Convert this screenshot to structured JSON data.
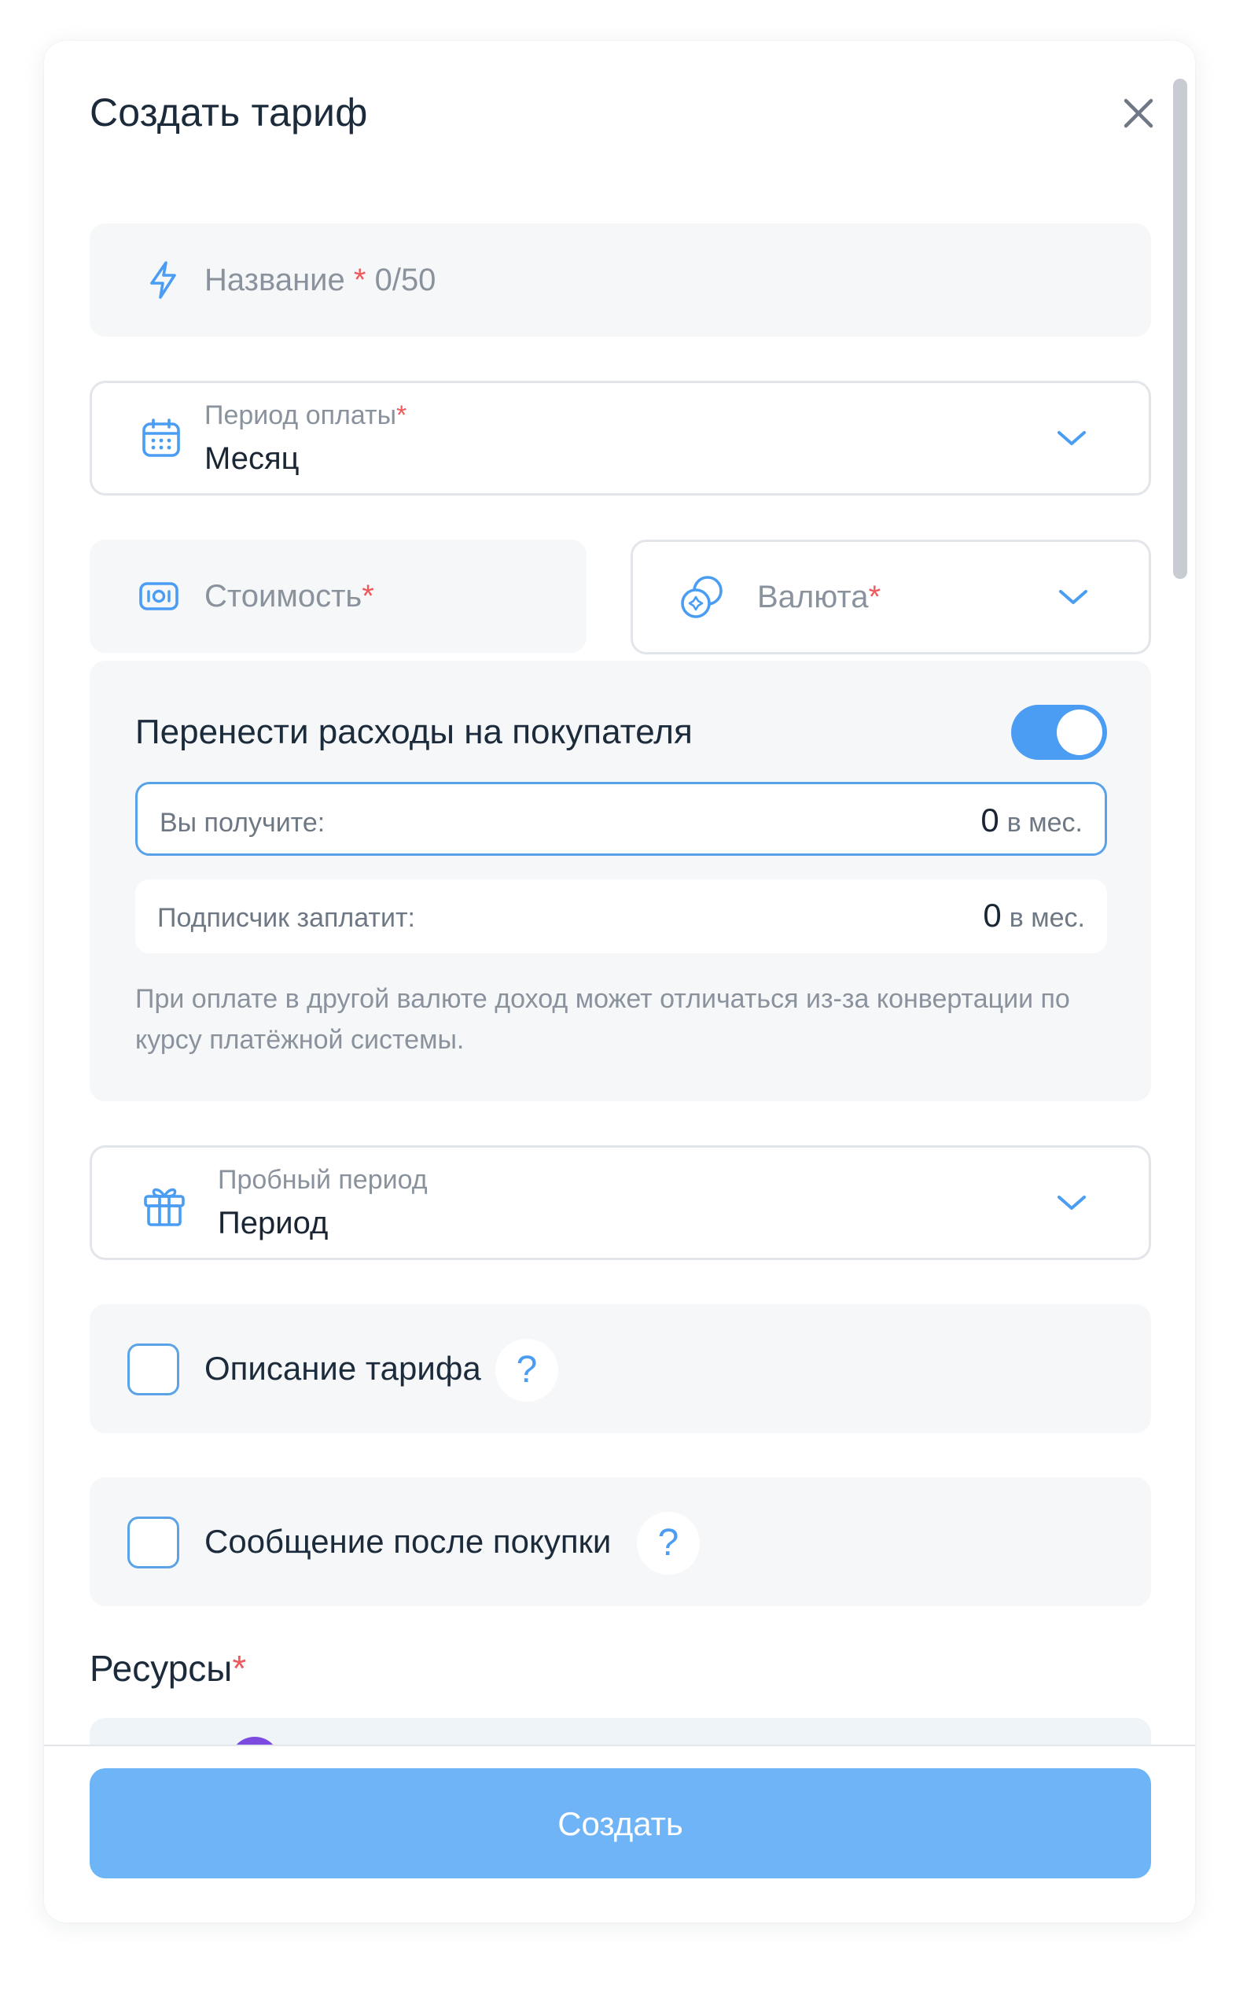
{
  "modal": {
    "title": "Создать тариф",
    "close_icon": "close-icon"
  },
  "name_field": {
    "placeholder": "Название",
    "required_mark": "*",
    "counter": "0/50",
    "icon": "lightning-icon"
  },
  "payment_period": {
    "label": "Период оплаты",
    "required_mark": "*",
    "value": "Месяц",
    "icon": "calendar-icon"
  },
  "price_field": {
    "placeholder": "Стоимость",
    "required_mark": "*",
    "icon": "money-icon"
  },
  "currency_field": {
    "placeholder": "Валюта",
    "required_mark": "*",
    "icon": "currency-icon"
  },
  "fees_panel": {
    "title": "Перенести расходы на покупателя",
    "toggle_on": true,
    "you_receive_label": "Вы получите:",
    "you_receive_value": "0",
    "subscriber_pays_label": "Подписчик заплатит:",
    "subscriber_pays_value": "0",
    "unit": "в мес.",
    "note": "При оплате в другой валюте доход может отличаться из-за конвертации по курсу платёжной системы."
  },
  "trial_period": {
    "label": "Пробный период",
    "value": "Период",
    "icon": "gift-icon"
  },
  "description_option": {
    "label": "Описание тарифа",
    "help": "?"
  },
  "after_purchase_option": {
    "label": "Сообщение после покупки",
    "help": "?"
  },
  "resources": {
    "title": "Ресурсы",
    "required_mark": "*"
  },
  "submit": {
    "label": "Создать"
  },
  "colors": {
    "accent": "#4a9df3",
    "required": "#f0595b",
    "button": "#55a8f6"
  }
}
